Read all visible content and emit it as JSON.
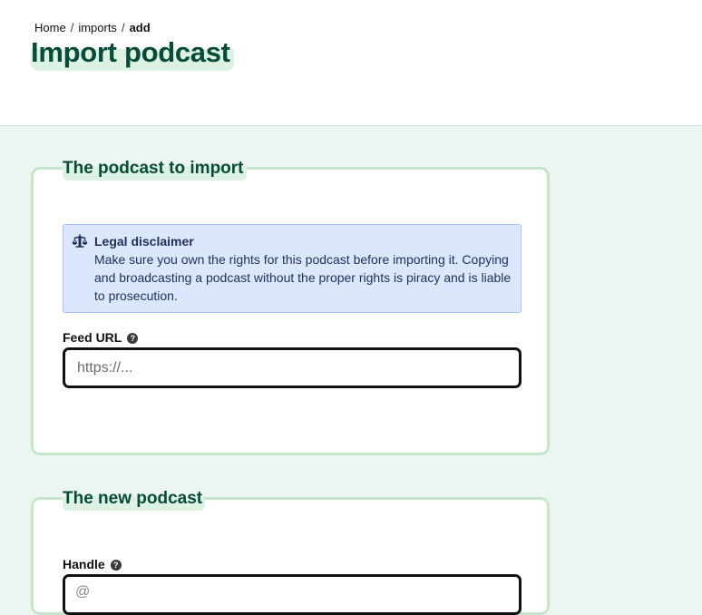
{
  "breadcrumb": {
    "items": [
      "Home",
      "imports"
    ],
    "current": "add",
    "separator": "/"
  },
  "page": {
    "title": "Import podcast"
  },
  "section_import": {
    "legend": "The podcast to import",
    "disclaimer": {
      "icon": "scale-balance-icon",
      "title": "Legal disclaimer",
      "text": "Make sure you own the rights for this podcast before importing it. Copying and broadcasting a podcast without the proper rights is piracy and is liable to prosecution."
    },
    "feed_url": {
      "label": "Feed URL",
      "help_icon": "?",
      "placeholder": "https://...",
      "value": ""
    }
  },
  "section_new": {
    "legend": "The new podcast",
    "handle": {
      "label": "Handle",
      "help_icon": "?",
      "prefix": "@",
      "value": ""
    }
  },
  "colors": {
    "page_background": "#ebf6f1",
    "header_background": "#ffffff",
    "title": "#094b3a",
    "highlight": "#dcf2e2",
    "fieldset_border": "#c6e6cc",
    "alert_background": "#dbe7fc",
    "alert_border": "#a9c3ee",
    "alert_text": "#1f2f5a",
    "input_border": "#111111"
  }
}
